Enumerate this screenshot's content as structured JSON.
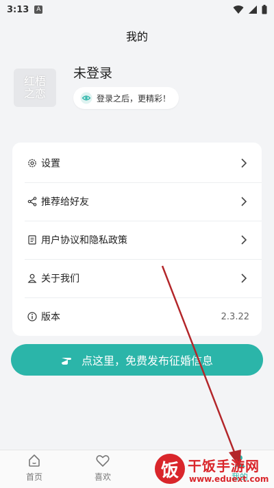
{
  "status_bar": {
    "time": "3:13",
    "badge": "A"
  },
  "header": {
    "title": "我的"
  },
  "profile": {
    "avatar_text_1": "红梧",
    "avatar_text_2": "之恋",
    "name": "未登录",
    "hint": "登录之后，更精彩！"
  },
  "menu": {
    "items": [
      {
        "label": "设置",
        "icon": "gear-icon"
      },
      {
        "label": "推荐给好友",
        "icon": "share-icon"
      },
      {
        "label": "用户协议和隐私政策",
        "icon": "document-icon"
      },
      {
        "label": "关于我们",
        "icon": "person-icon"
      },
      {
        "label": "版本",
        "icon": "info-icon",
        "value": "2.3.22"
      }
    ]
  },
  "publish": {
    "label": "点这里，免费发布征婚信息",
    "icon": "pointing-hand-icon"
  },
  "tabs": [
    {
      "label": "首页",
      "icon": "home-icon"
    },
    {
      "label": "喜欢",
      "icon": "heart-icon"
    },
    {
      "label": "",
      "icon": "message-icon"
    },
    {
      "label": "我的",
      "icon": "user-icon",
      "active": true
    }
  ],
  "watermark": {
    "logo_char": "饭",
    "title": "干饭手游网",
    "url": "www.eduext.com"
  },
  "colors": {
    "accent": "#2bb5a9",
    "annotation_arrow": "#b3262a",
    "watermark": "#d9262b"
  }
}
